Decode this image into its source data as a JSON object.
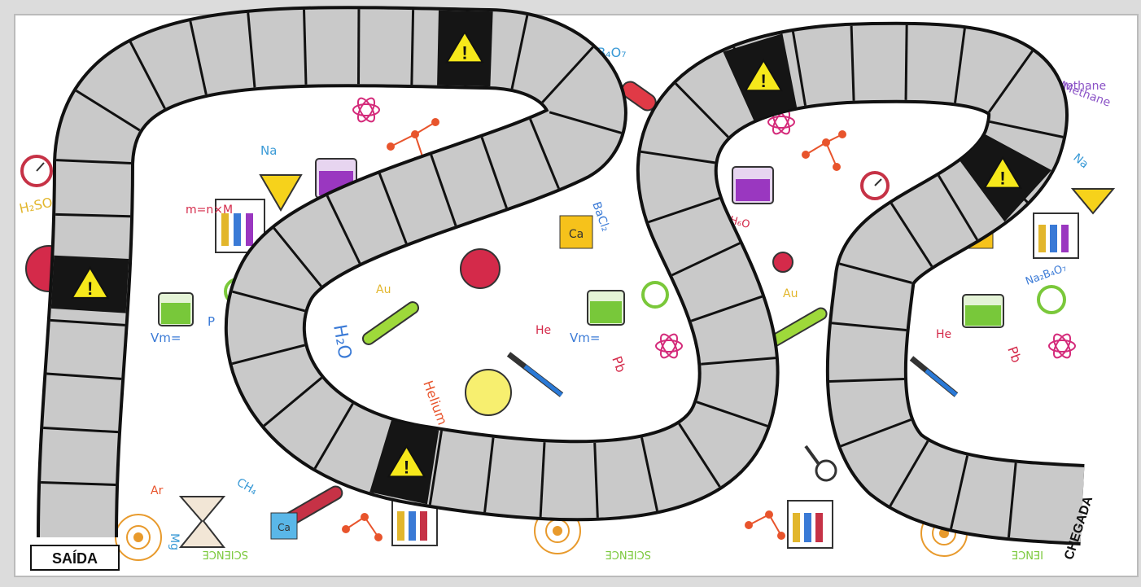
{
  "board": {
    "start_label": "SAÍDA",
    "finish_label": "CHEGADA",
    "hazard_symbol": "!",
    "hazard_icon": "warning-triangle-icon",
    "colors": {
      "board_paper": "#ffffff",
      "track_fill": "#c9c9c9",
      "track_outline": "#111111",
      "hazard_square": "#151515",
      "hazard_sign": "#f6e81b"
    }
  },
  "decorations": {
    "formulas": [
      "Na₂B₄O₇",
      "Methane",
      "Na",
      "H₂SO₄",
      "m=n×M",
      "BaCl₂",
      "C₂H₆O",
      "H₂O",
      "Au",
      "He",
      "Pb",
      "Helium",
      "CH₄",
      "Ar",
      "Mg",
      "P",
      "Na₂B₄O₇",
      "m=n×M",
      "Na",
      "Au",
      "He",
      "Pb",
      "Helium",
      "Methane",
      "Vm=",
      "Vm=",
      "Ca",
      "Ca",
      "Ca",
      "SCIENCE",
      "SCIENCE",
      "IENCE"
    ]
  }
}
